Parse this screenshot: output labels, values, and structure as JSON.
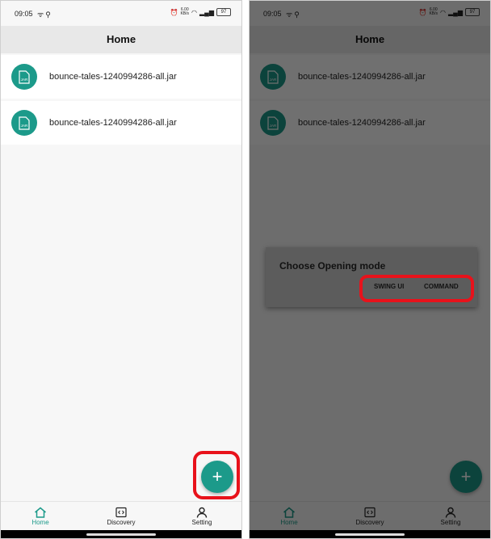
{
  "status": {
    "time": "09:05",
    "net_speed_top": "6.00",
    "net_speed_unit": "KB/s",
    "battery": "97"
  },
  "appbar": {
    "title": "Home"
  },
  "files": [
    {
      "name": "bounce-tales-1240994286-all.jar",
      "icon_label": "JAR"
    },
    {
      "name": "bounce-tales-1240994286-all.jar",
      "icon_label": "JAR"
    }
  ],
  "fab": {
    "label": "+"
  },
  "nav": [
    {
      "label": "Home",
      "icon": "home-icon",
      "active": true
    },
    {
      "label": "Discovery",
      "icon": "code-icon",
      "active": false
    },
    {
      "label": "Setting",
      "icon": "person-icon",
      "active": false
    }
  ],
  "dialog": {
    "title": "Choose Opening mode",
    "swing_label": "SWING UI",
    "command_label": "COMMAND"
  },
  "colors": {
    "accent": "#1c9a8a",
    "highlight": "#e8121b"
  }
}
